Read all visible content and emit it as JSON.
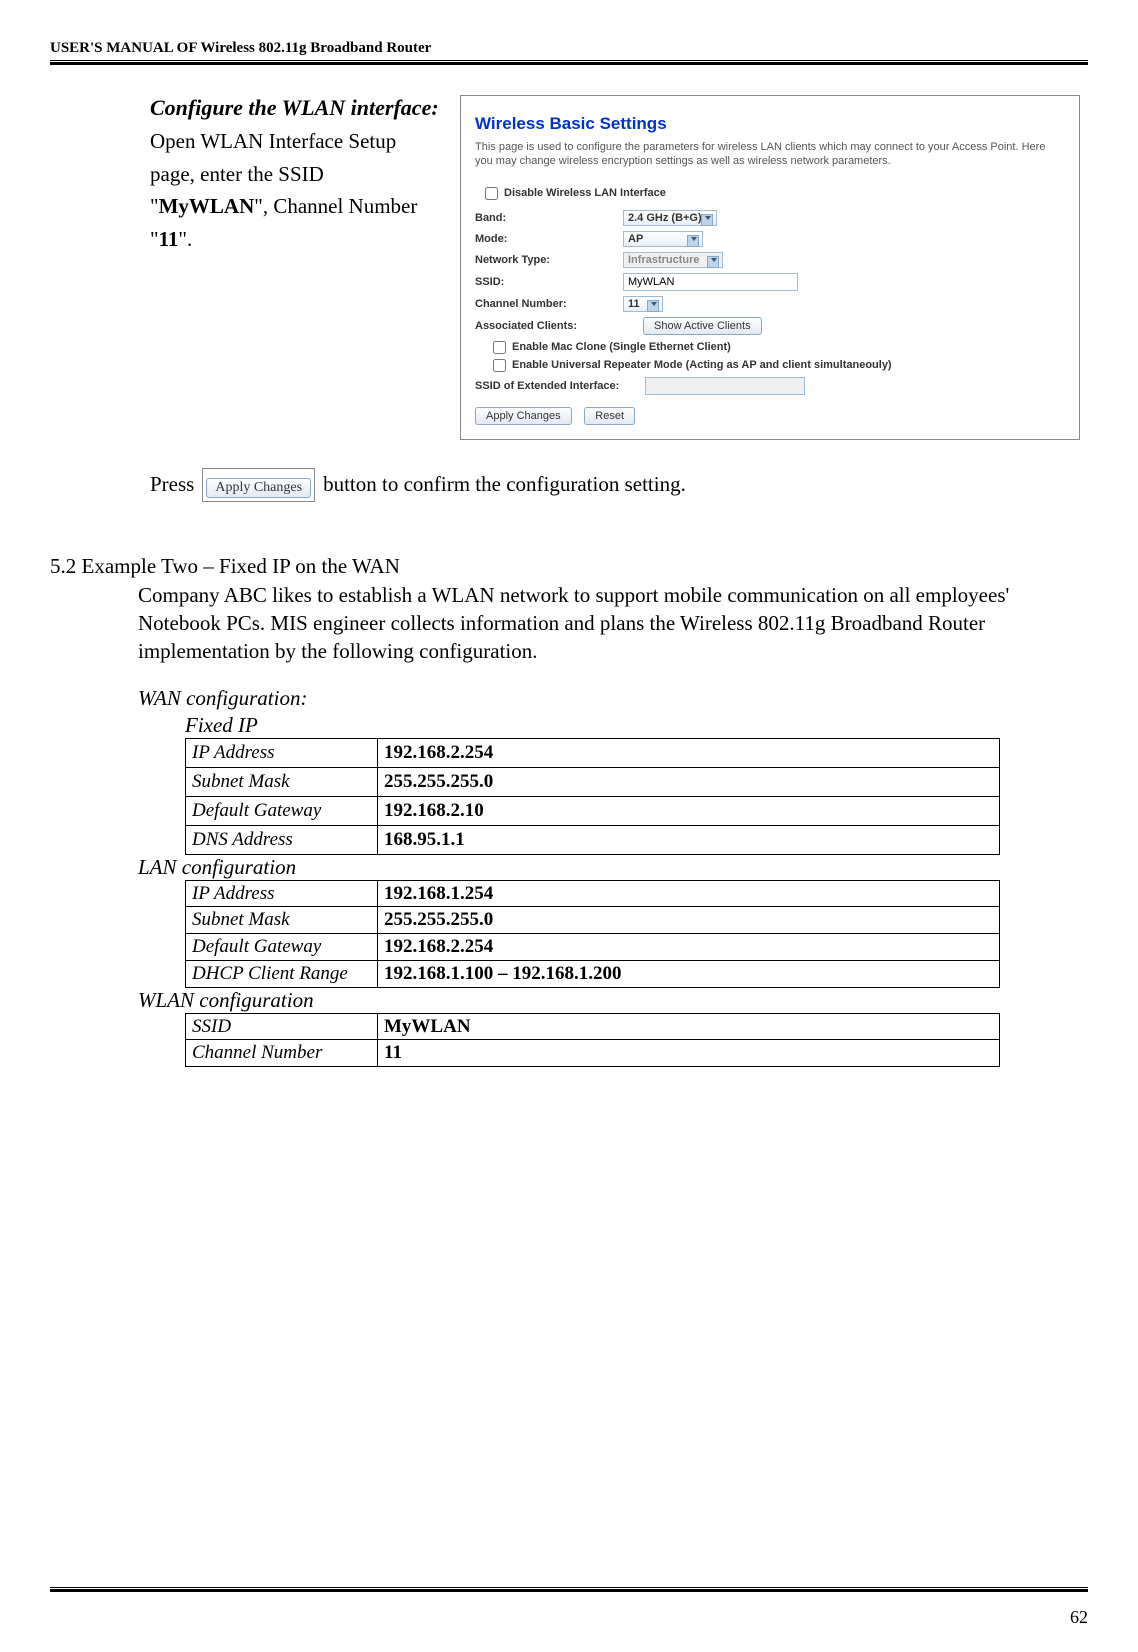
{
  "header": "USER'S MANUAL OF Wireless 802.11g Broadband Router",
  "page_number": "62",
  "step_left": {
    "heading": "Configure the WLAN interface:",
    "body_line1": "Open WLAN Interface Setup page, enter the SSID \"",
    "ssid_name": "MyWLAN",
    "body_line2": "\", Channel Number \"",
    "channel_num": "11",
    "body_line3": "\"."
  },
  "panel": {
    "title": "Wireless Basic Settings",
    "desc": "This page is used to configure the parameters for wireless LAN clients which may connect to your Access Point. Here you may change wireless encryption settings as well as wireless network parameters.",
    "disable_lan": "Disable Wireless LAN Interface",
    "band_label": "Band:",
    "band_value": "2.4 GHz (B+G)",
    "mode_label": "Mode:",
    "mode_value": "AP",
    "network_type_label": "Network Type:",
    "network_type_value": "Infrastructure",
    "ssid_label": "SSID:",
    "ssid_value": "MyWLAN",
    "channel_label": "Channel Number:",
    "channel_value": "11",
    "assoc_label": "Associated Clients:",
    "assoc_btn": "Show Active Clients",
    "mac_clone": "Enable Mac Clone (Single Ethernet Client)",
    "repeater": "Enable Universal Repeater Mode (Acting as AP and client simultaneouly)",
    "ext_iface": "SSID of Extended Interface:",
    "apply": "Apply Changes",
    "reset": "Reset"
  },
  "press_row": {
    "press": "Press",
    "btn": "Apply Changes",
    "after": "  button to confirm the configuration setting."
  },
  "example_two": {
    "heading": "5.2 Example Two – Fixed IP on the WAN",
    "body": "Company ABC likes to establish a WLAN network to support mobile communication on all employees' Notebook PCs. MIS engineer collects information and plans the Wireless 802.11g Broadband Router implementation by the following configuration."
  },
  "wan_label": "WAN configuration:",
  "fixed_ip_label": "Fixed IP",
  "wan_table": {
    "r1k": "IP Address",
    "r1v": "192.168.2.254",
    "r2k": "Subnet Mask",
    "r2v": "255.255.255.0",
    "r3k": "Default Gateway",
    "r3v": "192.168.2.10",
    "r4k": "DNS Address",
    "r4v": "168.95.1.1"
  },
  "lan_label": "LAN configuration",
  "lan_table": {
    "r1k": "IP Address",
    "r1v": "192.168.1.254",
    "r2k": "Subnet Mask",
    "r2v": "255.255.255.0",
    "r3k": "Default Gateway",
    "r3v": "192.168.2.254",
    "r4k": "DHCP Client Range",
    "r4v": "192.168.1.100 – 192.168.1.200"
  },
  "wlan_label": "WLAN configuration",
  "wlan_table": {
    "r1k": "SSID",
    "r1v": "MyWLAN",
    "r2k": "Channel Number",
    "r2v": "11"
  }
}
